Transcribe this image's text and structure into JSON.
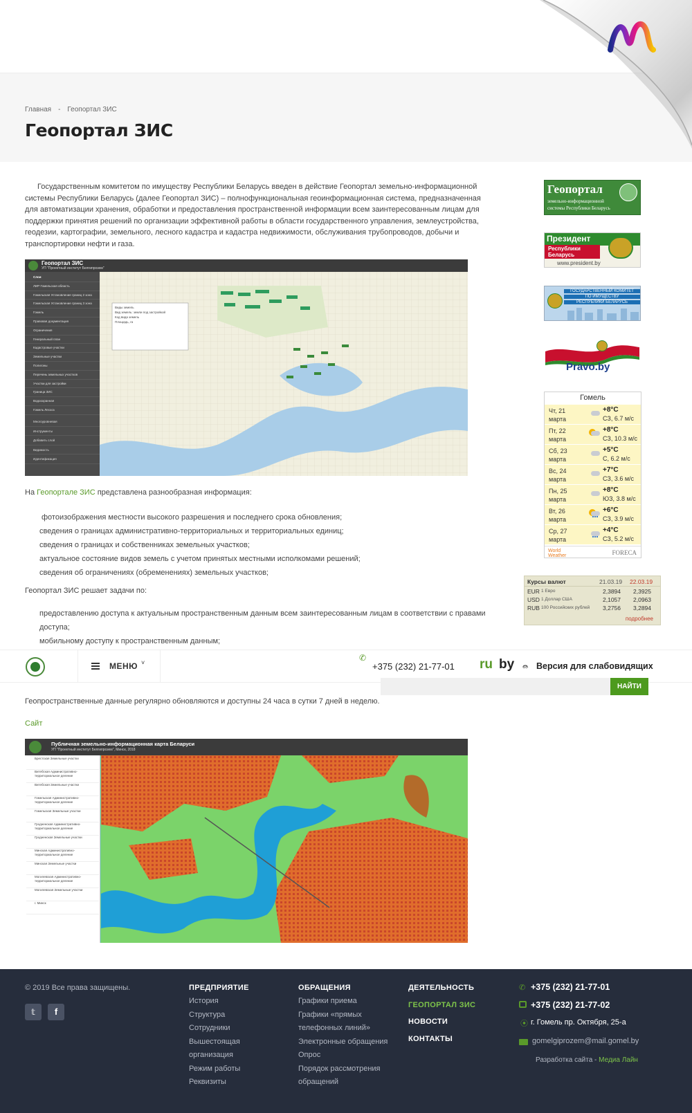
{
  "page": {
    "breadcrumb": [
      "Главная",
      "-",
      "Геопортал ЗИС"
    ],
    "title": "Геопортал ЗИС"
  },
  "content": {
    "intro": "Государственным комитетом по имуществу Республики Беларусь введен в действие Геопортал земельно-информационной системы Республики Беларусь (далее Геопортал ЗИС) – полнофункциональная геоинформационная система, предназначенная для автоматизации хранения, обработки и предоставления пространственной информации всем заинтересованным лицам для поддержки принятия решений по организации эффективной работы в области государственного управления, землеустройства, геодезии, картографии, земельного, лесного кадастра и кадастра недвижимости, обслуживания трубопроводов, добычи и транспортировки нефти и газа.",
    "info_prefix": "На",
    "info_link": "Геопортале ЗИС",
    "info_suffix": "представлена разнообразная информация:",
    "info_items": [
      "фотоизображения местности высокого разрешения и последнего срока обновления;",
      "сведения о границах административно-территориальных и территориальных единиц;",
      "сведения о границах и собственниках земельных участков;",
      "актуальное состояние видов земель с учетом принятых местными исполкомами решений;",
      "сведения об ограничениях (обременениях) земельных участков;"
    ],
    "tasks_heading": "Геопортал ЗИС решает задачи по:",
    "tasks_items": [
      "предоставлению доступа к актуальным пространственным данным всем заинтересованным лицам в соответствии с правами доступа;",
      "мобильному доступу к пространственным данным;"
    ],
    "update_text": "Геопространственные данные регулярно обновляются и доступны 24 часа в сутки 7 дней в неделю.",
    "site_link": "Сайт"
  },
  "map1": {
    "title": "Геопортал ЗИС",
    "subtitle": "УП \"Проектный институт Белгипрозем\"",
    "layers": [
      "Слои",
      "ЛИР Гомельская область",
      "Гомельская Установление границ 2 зона",
      "Гомельская Установление границ 3 зона",
      "Гомель",
      "Правовая документация",
      "Ограничения",
      "Генеральный план",
      "Кадастровые участки",
      "Земельные участки",
      "Полигоны",
      "Перечень земельных участков",
      "Участки для застройки",
      "Граница ЗИС",
      "Водоохранная",
      "Гомель Лесхоз"
    ],
    "bottom": [
      "Многоуровневая",
      "Инструменты",
      "Добавить слой",
      "Видимость",
      "Идентификация"
    ],
    "popup": [
      "Виды земель",
      "Вид земель: земли под застройкой",
      "Код вида земель",
      "Площадь, га"
    ]
  },
  "map2": {
    "title": "Публичная земельно-информационная карта Беларуси",
    "subtitle": "УП \"Проектный институт Белгипрозем\", Минск, 2018",
    "layers": [
      "Брестская Земельные участки",
      "Витебская Административно-территориальное деление",
      "Витебская Земельные участки",
      "Гомельская Административно-территориальное деление",
      "Гомельская Земельные участки",
      "Гродненская Административно-территориальное деление",
      "Гродненская Земельные участки",
      "Минская Административно-территориальное деление",
      "Минская Земельные участки",
      "Могилевская Административно-территориальное деление",
      "Могилевская Земельные участки",
      "г. Минск"
    ]
  },
  "sidebar": {
    "banner_geoportal": [
      "Геопортал",
      "земельно-информационной",
      "системы Республики Беларусь"
    ],
    "banner_president": [
      "Президент",
      "Республики",
      "Беларусь",
      "www.president.by"
    ],
    "banner_goskom": [
      "ГОСУДАРСТВЕННЫЙ КОМИТЕТ",
      "ПО ИМУЩЕСТВУ",
      "РЕСПУБЛИКИ БЕЛАРУСЬ"
    ],
    "banner_pravo": "Pravo.by"
  },
  "weather": {
    "city": "Гомель",
    "days": [
      {
        "day": "Чт, 21",
        "month": "марта",
        "temp": "+8°C",
        "wind": "СЗ, 6.7 м/с",
        "icon": "cloud-icon"
      },
      {
        "day": "Пт, 22",
        "month": "марта",
        "temp": "+8°C",
        "wind": "СЗ, 10.3 м/с",
        "icon": "sun-cloud-icon"
      },
      {
        "day": "Сб, 23",
        "month": "марта",
        "temp": "+5°C",
        "wind": "С, 6.2 м/с",
        "icon": "cloud-icon"
      },
      {
        "day": "Вс, 24",
        "month": "марта",
        "temp": "+7°C",
        "wind": "СЗ, 3.6 м/с",
        "icon": "cloud-icon"
      },
      {
        "day": "Пн, 25",
        "month": "марта",
        "temp": "+8°C",
        "wind": "ЮЗ, 3.8 м/с",
        "icon": "cloud-icon"
      },
      {
        "day": "Вт, 26",
        "month": "марта",
        "temp": "+6°C",
        "wind": "СЗ, 3.9 м/с",
        "icon": "sun-rain-icon"
      },
      {
        "day": "Ср, 27",
        "month": "марта",
        "temp": "+4°C",
        "wind": "СЗ, 5.2 м/с",
        "icon": "rain-icon"
      }
    ],
    "brand_left": "World Weather",
    "brand_right": "FORECA"
  },
  "rates": {
    "title": "Курсы валют",
    "date1": "21.03.19",
    "date2": "22.03.19",
    "rows": [
      {
        "code": "EUR",
        "name": "1 Евро",
        "v1": "2,3894",
        "v2": "2,3925"
      },
      {
        "code": "USD",
        "name": "1 Доллар США",
        "v1": "2,1057",
        "v2": "2,0963"
      },
      {
        "code": "RUB",
        "name": "100 Российских рублей",
        "v1": "3,2756",
        "v2": "3,2894"
      }
    ],
    "more": "подробнее"
  },
  "nav": {
    "menu": "МЕНЮ",
    "phone": "+375 (232) 21-77-01",
    "lang_ru": "ru",
    "lang_by": "by",
    "accessibility": "Версия для слабовидящих",
    "search_placeholder": "",
    "search_button": "НАЙТИ"
  },
  "footer": {
    "copyright": "© 2019 Все права защищены.",
    "col1": {
      "title": "ПРЕДПРИЯТИЕ",
      "items": [
        "История",
        "Структура",
        "Сотрудники",
        "Вышестоящая",
        "организация",
        "Режим работы",
        "Реквизиты"
      ]
    },
    "col2": {
      "title": "ОБРАЩЕНИЯ",
      "items": [
        "Графики приема",
        "Графики «прямых",
        "телефонных линий»",
        "Электронные обращения",
        "Опрос",
        "Порядок рассмотрения",
        "обращений"
      ]
    },
    "col3": [
      {
        "label": "ДЕЯТЕЛЬНОСТЬ",
        "active": false
      },
      {
        "label": "ГЕОПОРТАЛ ЗИС",
        "active": true
      },
      {
        "label": "НОВОСТИ",
        "active": false
      },
      {
        "label": "КОНТАКТЫ",
        "active": false
      }
    ],
    "phone1": "+375 (232) 21-77-01",
    "phone2": "+375 (232) 21-77-02",
    "address": "г. Гомель пр. Октября, 25-а",
    "email": "gomelgiprozem@mail.gomel.by",
    "dev_prefix": "Разработка сайта -",
    "dev_link": "Медиа Лайн"
  },
  "colors": {
    "accent": "#5a9a2a",
    "footer_bg": "#262d3c",
    "weather_bg": "#fdf6c4"
  }
}
